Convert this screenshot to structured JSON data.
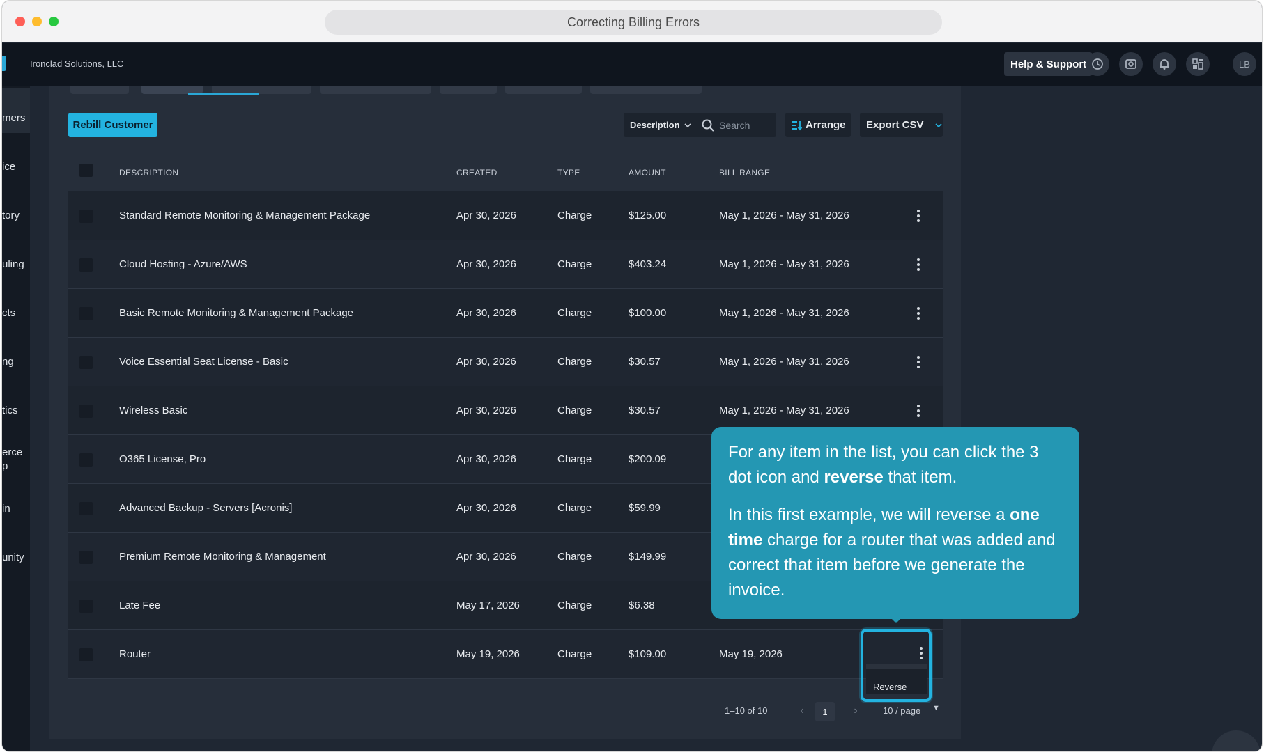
{
  "window": {
    "title": "Correcting Billing Errors"
  },
  "header": {
    "company": "Ironclad Solutions, LLC",
    "help_label": "Help & Support",
    "icons": [
      "history-icon",
      "screenshot-icon",
      "bell-icon",
      "dashboard-icon"
    ],
    "avatar_initials": "LB"
  },
  "sidebar": {
    "items": [
      {
        "label": "mers"
      },
      {
        "label": "ice"
      },
      {
        "label": "tory"
      },
      {
        "label": "uling"
      },
      {
        "label": "cts"
      },
      {
        "label": "ng"
      },
      {
        "label": "tics"
      },
      {
        "label": "erce"
      },
      {
        "label": "p"
      },
      {
        "label": "in"
      },
      {
        "label": "unity"
      }
    ]
  },
  "toolbar": {
    "rebill_label": "Rebill Customer",
    "filter_label": "Description",
    "search_placeholder": "Search",
    "arrange_label": "Arrange",
    "export_label": "Export CSV"
  },
  "table": {
    "columns": [
      "DESCRIPTION",
      "CREATED",
      "TYPE",
      "AMOUNT",
      "BILL RANGE"
    ],
    "rows": [
      {
        "description": "Standard Remote Monitoring & Management Package",
        "created": "Apr 30, 2026",
        "type": "Charge",
        "amount": "$125.00",
        "range": "May 1, 2026 - May 31, 2026"
      },
      {
        "description": "Cloud Hosting - Azure/AWS",
        "created": "Apr 30, 2026",
        "type": "Charge",
        "amount": "$403.24",
        "range": "May 1, 2026 - May 31, 2026"
      },
      {
        "description": "Basic Remote Monitoring & Management Package",
        "created": "Apr 30, 2026",
        "type": "Charge",
        "amount": "$100.00",
        "range": "May 1, 2026 - May 31, 2026"
      },
      {
        "description": "Voice Essential Seat License - Basic",
        "created": "Apr 30, 2026",
        "type": "Charge",
        "amount": "$30.57",
        "range": "May 1, 2026 - May 31, 2026"
      },
      {
        "description": "Wireless Basic",
        "created": "Apr 30, 2026",
        "type": "Charge",
        "amount": "$30.57",
        "range": "May 1, 2026 - May 31, 2026"
      },
      {
        "description": "O365 License, Pro",
        "created": "Apr 30, 2026",
        "type": "Charge",
        "amount": "$200.09",
        "range": ""
      },
      {
        "description": "Advanced Backup - Servers [Acronis]",
        "created": "Apr 30, 2026",
        "type": "Charge",
        "amount": "$59.99",
        "range": ""
      },
      {
        "description": "Premium Remote Monitoring & Management",
        "created": "Apr 30, 2026",
        "type": "Charge",
        "amount": "$149.99",
        "range": ""
      },
      {
        "description": "Late Fee",
        "created": "May 17, 2026",
        "type": "Charge",
        "amount": "$6.38",
        "range": ""
      },
      {
        "description": "Router",
        "created": "May 19, 2026",
        "type": "Charge",
        "amount": "$109.00",
        "range": "May 19, 2026"
      }
    ]
  },
  "row_menu": {
    "reverse_label": "Reverse"
  },
  "pagination": {
    "count": "1–10 of 10",
    "current_page": "1",
    "page_size": "10 / page"
  },
  "tooltip": {
    "p1_a": "For any item in the list, you can click the 3 dot icon and ",
    "p1_b": "reverse",
    "p1_c": " that item.",
    "p2_a": "In this first example, we will reverse a ",
    "p2_b": "one time",
    "p2_c": " charge for a router that was added and correct that item before we generate the invoice."
  },
  "colors": {
    "accent": "#23b3e0",
    "tooltip": "#2497b3",
    "panel": "#262e3a",
    "topbar": "#0f151e"
  }
}
